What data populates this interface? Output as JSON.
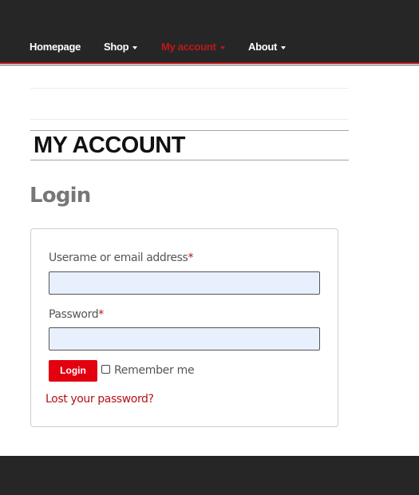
{
  "nav": {
    "items": [
      {
        "label": "Homepage",
        "dropdown": false,
        "active": false
      },
      {
        "label": "Shop",
        "dropdown": true,
        "active": false
      },
      {
        "label": "My account",
        "dropdown": true,
        "active": true
      },
      {
        "label": "About",
        "dropdown": true,
        "active": false
      }
    ]
  },
  "page": {
    "title": "MY ACCOUNT",
    "section_title": "Login"
  },
  "login_form": {
    "username_label": "Userame or email address",
    "password_label": "Password",
    "required_marker": "*",
    "username_value": "",
    "password_value": "",
    "login_button": "Login",
    "remember_me": "Remember me",
    "remember_checked": false,
    "lost_password": "Lost your password?"
  },
  "colors": {
    "header_bg": "#262626",
    "accent_red": "#b31217",
    "button_red": "#e3000f",
    "input_bg": "#e8f0fe"
  }
}
